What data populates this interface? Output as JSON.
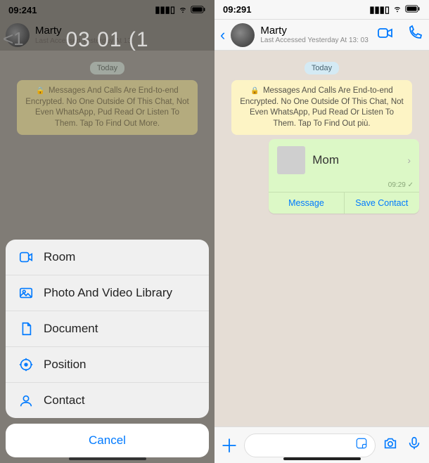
{
  "left": {
    "time": "09:241",
    "contact_name": "Marty",
    "last_accessed": "Last Accessed Yesterday At 13:",
    "overlay": "03 01 (1",
    "overlay_badge": "<1",
    "date_pill": "Today",
    "encryption": "Messages And Calls Are End-to-end Encrypted. No One Outside Of This Chat, Not Even WhatsApp, Pud Read Or Listen To Them. Tap To Find Out More.",
    "sheet": {
      "room": "Room",
      "photo": "Photo And Video Library",
      "document": "Document",
      "position": "Position",
      "contact": "Contact",
      "cancel": "Cancel"
    }
  },
  "right": {
    "time": "09:291",
    "contact_name": "Marty",
    "last_accessed": "Last Accessed Yesterday At 13: 03",
    "date_pill": "Today",
    "encryption": "Messages And Calls Are End-to-end Encrypted. No One Outside Of This Chat, Not Even WhatsApp, Pud Read Or Listen To Them. Tap To Find Out più.",
    "shared_contact": {
      "name": "Mom",
      "time": "09:29",
      "action_message": "Message",
      "action_save": "Save Contact"
    }
  }
}
